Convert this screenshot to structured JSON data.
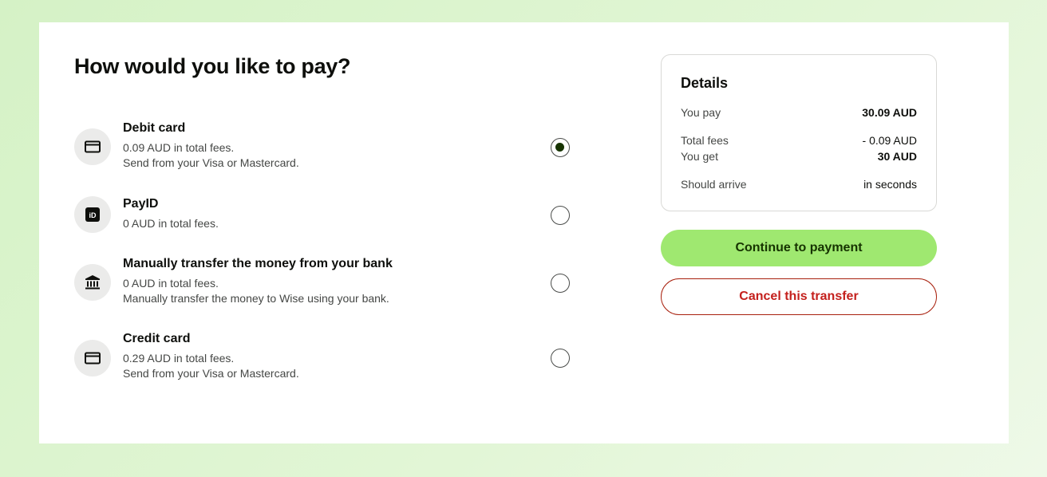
{
  "page": {
    "title": "How would you like to pay?"
  },
  "options": [
    {
      "name": "Debit card",
      "lines": [
        "0.09 AUD in total fees.",
        "Send from your Visa or Mastercard."
      ],
      "icon": "card-icon",
      "selected": true
    },
    {
      "name": "PayID",
      "lines": [
        "0 AUD in total fees."
      ],
      "icon": "payid-icon",
      "selected": false
    },
    {
      "name": "Manually transfer the money from your bank",
      "lines": [
        "0 AUD in total fees.",
        "Manually transfer the money to Wise using your bank."
      ],
      "icon": "bank-icon",
      "selected": false
    },
    {
      "name": "Credit card",
      "lines": [
        "0.29 AUD in total fees.",
        "Send from your Visa or Mastercard."
      ],
      "icon": "card-icon",
      "selected": false
    }
  ],
  "details": {
    "title": "Details",
    "rows": [
      {
        "label": "You pay",
        "value": "30.09 AUD"
      },
      {
        "label": "Total fees",
        "value": "- 0.09 AUD"
      },
      {
        "label": "You get",
        "value": "30 AUD"
      },
      {
        "label": "Should arrive",
        "value": "in seconds"
      }
    ]
  },
  "actions": {
    "continue_label": "Continue to payment",
    "cancel_label": "Cancel this transfer"
  },
  "colors": {
    "accent": "#9fe870",
    "accent_text": "#163300",
    "danger": "#c4201d"
  }
}
